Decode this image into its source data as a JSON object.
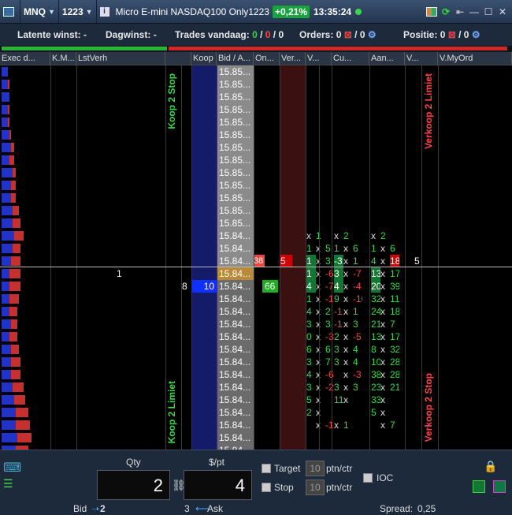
{
  "titlebar": {
    "symbol": "MNQ",
    "contract": "1223",
    "info_icon": "i",
    "name": "Micro E-mini NASDAQ100 Only1223",
    "change": "+0,21%",
    "time": "13:35:24"
  },
  "stats": {
    "latent_label": "Latente winst:",
    "latent_value": "-",
    "day_label": "Dagwinst:",
    "day_value": "-",
    "trades_label": "Trades vandaag:",
    "trades_a": "0",
    "trades_b": "0",
    "trades_c": "0",
    "orders_label": "Orders:",
    "orders_a": "0",
    "orders_b": "0",
    "pos_label": "Positie:",
    "pos_a": "0",
    "pos_b": "0"
  },
  "columns": [
    "Exec d...",
    "K.M...",
    "LstVerh",
    "",
    "Koop",
    "Bid / A...",
    "On...",
    "Ver...",
    "V...",
    "Cu...",
    "Aan...",
    "V...",
    "V.MyOrd"
  ],
  "price_rows": [
    "15.85...",
    "15.85...",
    "15.85...",
    "15.85...",
    "15.85...",
    "15.85...",
    "15.85...",
    "15.85...",
    "15.85...",
    "15.85...",
    "15.85...",
    "15.85...",
    "15.85...",
    "15.84...",
    "15.84...",
    "15.84...",
    "15.84...",
    "15.84...",
    "15.84...",
    "15.84...",
    "15.84...",
    "15.84...",
    "15.84...",
    "15.84...",
    "15.84...",
    "15.84...",
    "15.84...",
    "15.84...",
    "15.84...",
    "15.84...",
    "15.84...",
    "15.84...",
    "15.84...",
    "15.84..."
  ],
  "markers": {
    "lastverh": "1",
    "buy_left": "8",
    "buy_value": "10",
    "ask_left": "38",
    "ask_value": "5",
    "bid_qty": "66",
    "myorder": "5"
  },
  "labels": {
    "koop_stop": "Koop 2 Stop",
    "verkoop_limiet": "Verkoop 2 Limiet",
    "koop_limiet": "Koop 2 Limiet",
    "verkoop_stop": "Verkoop 2 Stop"
  },
  "cols_v": [
    [
      "x",
      "1"
    ],
    [
      "1",
      "x",
      "5"
    ],
    [
      "1",
      "x",
      "3"
    ],
    [
      "1",
      "x",
      "-6"
    ],
    [
      "4",
      "x",
      "-7"
    ],
    [
      "1",
      "x",
      "-1"
    ],
    [
      "4",
      "x",
      "2"
    ],
    [
      "3",
      "x",
      "3"
    ],
    [
      "0",
      "x",
      "-3"
    ],
    [
      "6",
      "x",
      "6"
    ],
    [
      "3",
      "x",
      "7"
    ],
    [
      "4",
      "x",
      "-6"
    ],
    [
      "3",
      "x",
      "-2"
    ],
    [
      "5",
      "x"
    ],
    [
      "2",
      "x"
    ],
    [
      "",
      "x",
      "-1"
    ]
  ],
  "cols_cu": [
    [
      "x",
      "2"
    ],
    [
      "1",
      "x",
      "6"
    ],
    [
      "-3",
      "x",
      "1"
    ],
    [
      "3",
      "x",
      "-7"
    ],
    [
      "4",
      "x",
      "-4"
    ],
    [
      "9",
      "x",
      "-10"
    ],
    [
      "-1",
      "x",
      "1"
    ],
    [
      "-1",
      "x",
      "3"
    ],
    [
      "2",
      "x",
      "-5"
    ],
    [
      "3",
      "x",
      "4"
    ],
    [
      "3",
      "x",
      "4"
    ],
    [
      "",
      "x",
      "-3"
    ],
    [
      "3",
      "x",
      "3"
    ],
    [
      "11",
      "x"
    ],
    [
      "",
      ""
    ],
    [
      "x",
      "1"
    ]
  ],
  "cols_aan": [
    [
      "x",
      "2"
    ],
    [
      "1",
      "x",
      "6"
    ],
    [
      "4",
      "x",
      "18"
    ],
    [
      "13",
      "x",
      "17"
    ],
    [
      "20",
      "x",
      "39"
    ],
    [
      "32",
      "x",
      "11"
    ],
    [
      "24",
      "x",
      "18"
    ],
    [
      "21",
      "x",
      "7"
    ],
    [
      "13",
      "x",
      "17"
    ],
    [
      "8",
      "x",
      "32"
    ],
    [
      "10",
      "x",
      "28"
    ],
    [
      "38",
      "x",
      "28"
    ],
    [
      "23",
      "x",
      "21"
    ],
    [
      "33",
      "x"
    ],
    [
      "5",
      "x"
    ],
    [
      "",
      "x",
      "7"
    ]
  ],
  "bottom": {
    "qty_label": "Qty",
    "pt_label": "$/pt",
    "qty_value": "2",
    "pt_value": "4",
    "target_label": "Target",
    "stop_label": "Stop",
    "ptn_target": "10",
    "ptn_stop": "10",
    "ptn_unit": "ptn/ctr",
    "ioc_label": "IOC"
  },
  "footer": {
    "bid_label": "Bid",
    "bid_value": "2",
    "ask_value": "3",
    "ask_label": "Ask",
    "spread_label": "Spread:",
    "spread_value": "0,25"
  }
}
